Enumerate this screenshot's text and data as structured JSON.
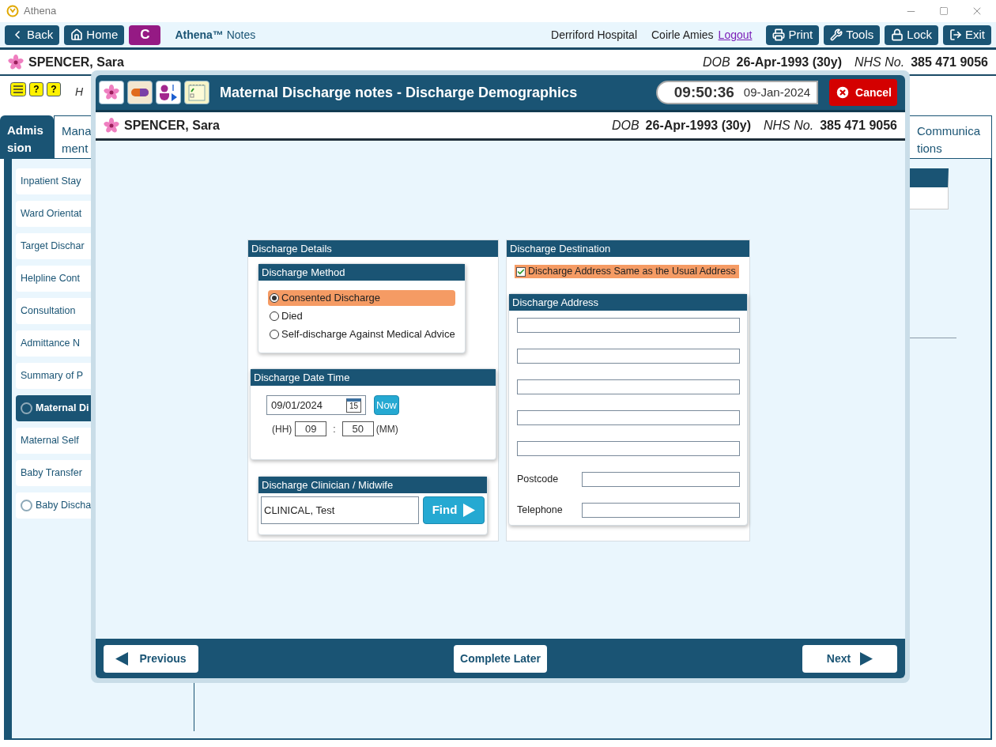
{
  "window": {
    "title": "Athena"
  },
  "toolbar": {
    "left_buttons": [
      {
        "kind": "back",
        "label": "Back"
      },
      {
        "kind": "home",
        "label": "Home"
      }
    ],
    "badge": "C",
    "app_name": "**Athena™** Notes",
    "location": "Derriford Hospital",
    "user": "Coirle Amies",
    "logout": "Logout",
    "right_buttons": [
      {
        "kind": "print",
        "label": "Print"
      },
      {
        "kind": "tools",
        "label": "Tools"
      },
      {
        "kind": "lock",
        "label": "Lock"
      },
      {
        "kind": "exit",
        "label": "Exit"
      }
    ]
  },
  "patient": {
    "name": "SPENCER, Sara",
    "dob_label": "DOB",
    "dob": "26-Apr-1993 (30y)",
    "nhs_label": "NHS No.",
    "nhs": "385 471 9056"
  },
  "alert_row": {
    "help_badges": [
      "?",
      "?"
    ],
    "text": "H"
  },
  "tabs": [
    {
      "lines": [
        "Admis",
        "sion"
      ],
      "selected": true
    },
    {
      "lines": [
        "Mana",
        "ment"
      ],
      "selected": false
    },
    {
      "lines": [
        "Communica",
        "tions"
      ],
      "selected": false
    }
  ],
  "sidebar": {
    "items": [
      {
        "label": "Inpatient Stay",
        "kind": "plain",
        "selected": false
      },
      {
        "label": "Ward Orientat",
        "kind": "plain",
        "selected": false
      },
      {
        "label": "Target Dischar",
        "kind": "plain",
        "selected": false
      },
      {
        "label": "Helpline Cont",
        "kind": "plain",
        "selected": false
      },
      {
        "label": "Consultation",
        "kind": "plain",
        "selected": false
      },
      {
        "label": "Admittance N",
        "kind": "plain",
        "selected": false
      },
      {
        "label": "Summary of P",
        "kind": "plain",
        "selected": false
      },
      {
        "label": "Maternal Di",
        "kind": "radio",
        "selected": true
      },
      {
        "label": "Maternal Self",
        "kind": "plain",
        "selected": false
      },
      {
        "label": "Baby Transfer",
        "kind": "plain",
        "selected": false
      },
      {
        "label": "Baby Discha",
        "kind": "radio",
        "selected": false
      }
    ]
  },
  "modal": {
    "title": "Maternal Discharge notes - Discharge Demographics",
    "time": "09:50:36",
    "date": "09-Jan-2024",
    "cancel": "Cancel",
    "patient": {
      "name": "SPENCER, Sara",
      "dob_label": "DOB",
      "dob": "26-Apr-1993 (30y)",
      "nhs_label": "NHS No.",
      "nhs": "385 471 9056"
    },
    "details": {
      "title": "Discharge Details",
      "method": {
        "title": "Discharge Method",
        "options": [
          {
            "label": "Consented Discharge",
            "selected": true
          },
          {
            "label": "Died",
            "selected": false
          },
          {
            "label": "Self-discharge Against Medical Advice",
            "selected": false
          }
        ]
      },
      "date_time": {
        "title": "Discharge Date Time",
        "date": "09/01/2024",
        "calendar_day": "15",
        "now": "Now",
        "hh_label": "(HH)",
        "hour": "09",
        "separator": ":",
        "minute": "50",
        "mm_label": "(MM)"
      },
      "clinician": {
        "title": "Discharge Clinician / Midwife",
        "value": "CLINICAL, Test",
        "find": "Find"
      }
    },
    "destination": {
      "title": "Discharge Destination",
      "same_address": {
        "label": "Discharge Address Same as the Usual Address",
        "checked": true
      },
      "address": {
        "title": "Discharge Address",
        "fields": [
          {
            "kind": "line"
          },
          {
            "kind": "line"
          },
          {
            "kind": "line"
          },
          {
            "kind": "line"
          },
          {
            "kind": "line"
          },
          {
            "kind": "labeled",
            "label": "Postcode"
          },
          {
            "kind": "labeled",
            "label": "Telephone"
          }
        ]
      }
    },
    "footer": {
      "previous": "Previous",
      "complete_later": "Complete Later",
      "next": "Next"
    }
  }
}
